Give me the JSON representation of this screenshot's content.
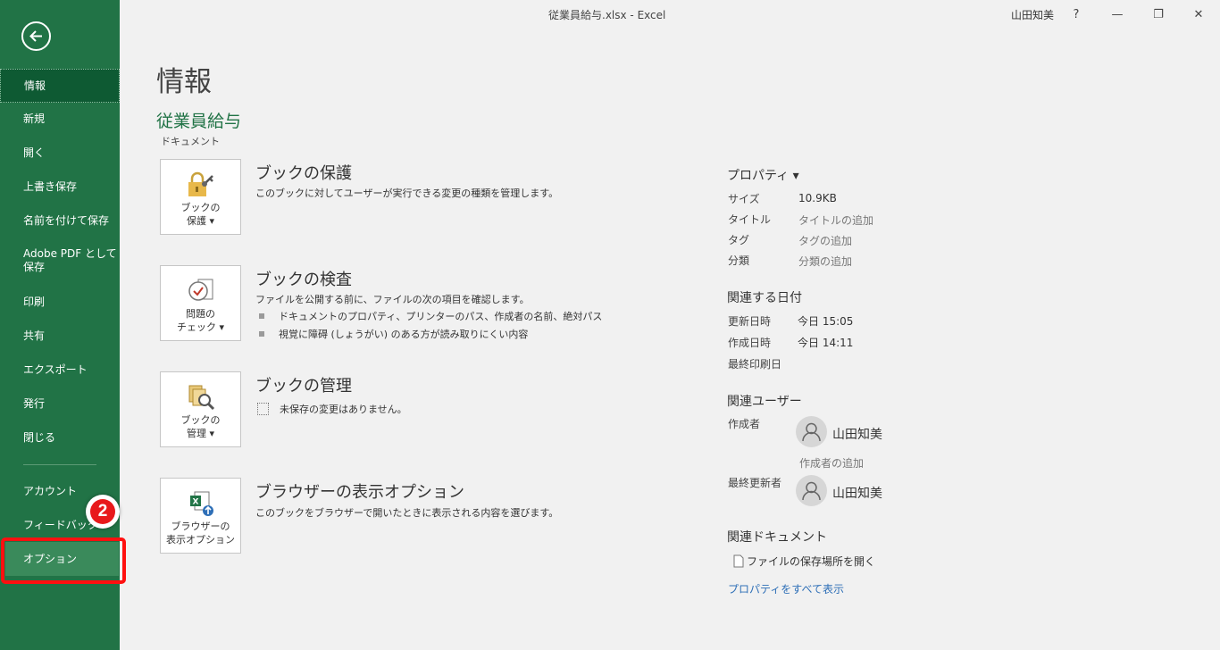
{
  "window": {
    "title": "従業員給与.xlsx  -  Excel",
    "user": "山田知美",
    "help": "?",
    "minimize": "—",
    "restore": "❐",
    "close": "✕"
  },
  "sidebar": {
    "items": [
      {
        "label": "情報"
      },
      {
        "label": "新規"
      },
      {
        "label": "開く"
      },
      {
        "label": "上書き保存"
      },
      {
        "label": "名前を付けて保存"
      },
      {
        "label": "Adobe PDF として\n保存"
      },
      {
        "label": "印刷"
      },
      {
        "label": "共有"
      },
      {
        "label": "エクスポート"
      },
      {
        "label": "発行"
      },
      {
        "label": "閉じる"
      },
      {
        "label": "アカウント"
      },
      {
        "label": "フィードバック"
      },
      {
        "label": "オプション"
      }
    ],
    "step_badge": "2"
  },
  "main": {
    "title": "情報",
    "doc_name": "従業員給与",
    "doc_path": "ドキュメント",
    "sections": [
      {
        "button_label": "ブックの\n保護 ▾",
        "title": "ブックの保護",
        "desc": "このブックに対してユーザーが実行できる変更の種類を管理します。"
      },
      {
        "button_label": "問題の\nチェック ▾",
        "title": "ブックの検査",
        "desc": "ファイルを公開する前に、ファイルの次の項目を確認します。",
        "bullets": [
          "ドキュメントのプロパティ、プリンターのパス、作成者の名前、絶対パス",
          "視覚に障碍 (しょうがい) のある方が読み取りにくい内容"
        ]
      },
      {
        "button_label": "ブックの\n管理 ▾",
        "title": "ブックの管理",
        "desc": "未保存の変更はありません。"
      },
      {
        "button_label": "ブラウザーの\n表示オプション",
        "title": "ブラウザーの表示オプション",
        "desc": "このブックをブラウザーで開いたときに表示される内容を選びます。"
      }
    ]
  },
  "properties": {
    "heading": "プロパティ ▾",
    "size_label": "サイズ",
    "size_value": "10.9KB",
    "title_label": "タイトル",
    "title_value": "タイトルの追加",
    "tags_label": "タグ",
    "tags_value": "タグの追加",
    "category_label": "分類",
    "category_value": "分類の追加",
    "dates_heading": "関連する日付",
    "modified_label": "更新日時",
    "modified_value": "今日 15:05",
    "created_label": "作成日時",
    "created_value": "今日 14:11",
    "printed_label": "最終印刷日",
    "people_heading": "関連ユーザー",
    "author_label": "作成者",
    "author_name": "山田知美",
    "add_author": "作成者の追加",
    "last_modified_by_label": "最終更新者",
    "last_modified_by_name": "山田知美",
    "docs_heading": "関連ドキュメント",
    "open_location": "ファイルの保存場所を開く",
    "show_all": "プロパティをすべて表示"
  }
}
